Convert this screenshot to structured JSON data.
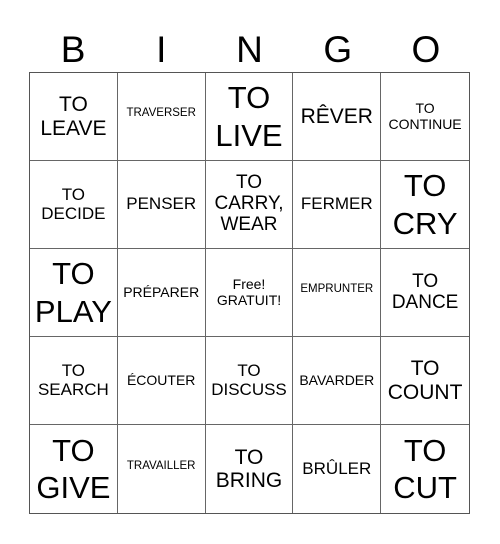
{
  "header": {
    "letters": [
      "B",
      "I",
      "N",
      "G",
      "O"
    ]
  },
  "cells": [
    {
      "text": "TO LEAVE",
      "size": "s-lg"
    },
    {
      "text": "TRAVERSER",
      "size": "s-xs"
    },
    {
      "text": "TO LIVE",
      "size": "s-xl"
    },
    {
      "text": "RÊVER",
      "size": "s-lg"
    },
    {
      "text": "TO CONTINUE",
      "size": "s-sm"
    },
    {
      "text": "TO DECIDE",
      "size": "s-md"
    },
    {
      "text": "PENSER",
      "size": "s-md"
    },
    {
      "text": "TO CARRY, WEAR",
      "size": "s-mdl"
    },
    {
      "text": "FERMER",
      "size": "s-md"
    },
    {
      "text": "TO CRY",
      "size": "s-xl"
    },
    {
      "text": "TO PLAY",
      "size": "s-xl"
    },
    {
      "text": "PRÉPARER",
      "size": "s-sm"
    },
    {
      "text": "Free! GRATUIT!",
      "size": "s-sm"
    },
    {
      "text": "EMPRUNTER",
      "size": "s-xs"
    },
    {
      "text": "TO DANCE",
      "size": "s-mdl"
    },
    {
      "text": "TO SEARCH",
      "size": "s-md"
    },
    {
      "text": "ÉCOUTER",
      "size": "s-sm"
    },
    {
      "text": "TO DISCUSS",
      "size": "s-md"
    },
    {
      "text": "BAVARDER",
      "size": "s-sm"
    },
    {
      "text": "TO COUNT",
      "size": "s-lg"
    },
    {
      "text": "TO GIVE",
      "size": "s-xl"
    },
    {
      "text": "TRAVAILLER",
      "size": "s-xs"
    },
    {
      "text": "TO BRING",
      "size": "s-lg"
    },
    {
      "text": "BRÛLER",
      "size": "s-md"
    },
    {
      "text": "TO CUT",
      "size": "s-xl"
    }
  ]
}
